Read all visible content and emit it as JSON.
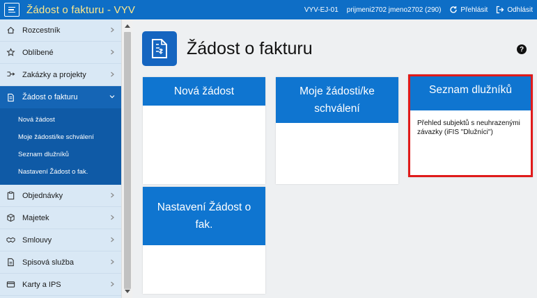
{
  "app": {
    "title": "Žádost o fakturu - VYV",
    "env": "VYV-EJ-01",
    "user": "prijmeni2702 jmeno2702 (290)",
    "relogin": "Přehlásit",
    "logout": "Odhlásit"
  },
  "sidebar": {
    "items": [
      {
        "label": "Rozcestník",
        "icon": "home-icon"
      },
      {
        "label": "Oblíbené",
        "icon": "star-icon"
      },
      {
        "label": "Zakázky a projekty",
        "icon": "project-icon"
      },
      {
        "label": "Žádost o fakturu",
        "icon": "document-icon"
      },
      {
        "label": "Objednávky",
        "icon": "clipboard-icon"
      },
      {
        "label": "Majetek",
        "icon": "box-icon"
      },
      {
        "label": "Smlouvy",
        "icon": "handshake-icon"
      },
      {
        "label": "Spisová služba",
        "icon": "file-icon"
      },
      {
        "label": "Karty a IPS",
        "icon": "card-icon"
      }
    ],
    "sub_items": [
      {
        "label": "Nová žádost"
      },
      {
        "label": "Moje žádosti/ke schválení"
      },
      {
        "label": "Seznam dlužníků"
      },
      {
        "label": "Nastavení Žádost o fak."
      }
    ]
  },
  "main": {
    "title": "Žádost o fakturu",
    "tiles": [
      {
        "title": "Nová žádost",
        "desc": ""
      },
      {
        "title": "Moje žádosti/ke schválení",
        "desc": ""
      },
      {
        "title": "Seznam dlužníků",
        "desc": "Přehled subjektů s neuhrazenými závazky (iFIS \"Dlužníci\")"
      },
      {
        "title": "Nastavení Žádost o fak.",
        "desc": ""
      }
    ]
  },
  "colors": {
    "topbar": "#0e6ec6",
    "title_accent": "#ffe98a",
    "sidebar_bg": "#d9e8f5",
    "active_item": "#1565b5",
    "submenu_bg": "#0f5aa6",
    "tile_header": "#0f75d0",
    "highlight": "#e01a1a"
  }
}
